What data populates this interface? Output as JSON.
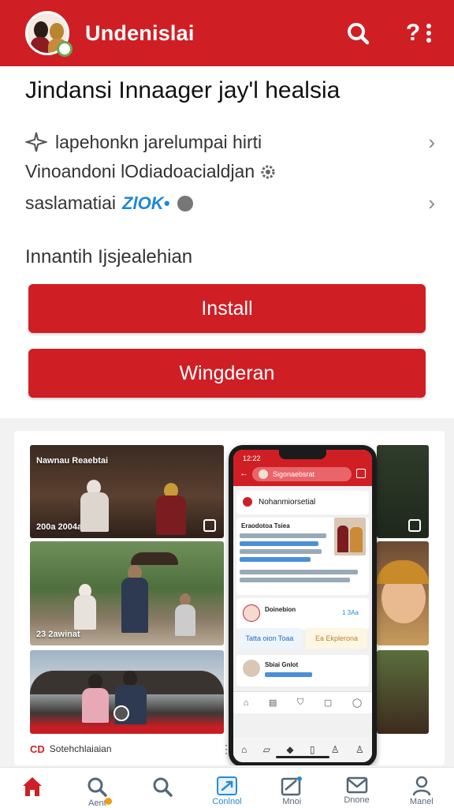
{
  "header": {
    "title": "Undenislai",
    "search_icon": "search-icon",
    "help_label": "?",
    "more_icon": "more-vertical-icon",
    "accent": "#cf1f24"
  },
  "info": {
    "title": "Jindansi Innaager jay'l healsia",
    "rows": [
      {
        "icon": "sparkle-icon",
        "text": "lapehonkn jarelumpai hirti",
        "chevron": "›"
      },
      {
        "text": "Vinoandoni lOdiadoacialdjan",
        "tail_icon": "settings-icon"
      },
      {
        "text": "saslamatiai",
        "tag": "ZlOK•",
        "tail_icon": "globe-icon",
        "chevron": "›"
      }
    ],
    "section_label": "Innantih Ijsjealehian",
    "install_label": "Install",
    "secondary_label": "Wingderan"
  },
  "gallery": {
    "photo1_label": "Nawnau Reaebtai",
    "photo1_sub": "200a 2004aan",
    "photo2_label": "23 2awinat",
    "footer_logo": "CD",
    "footer_text": "Sotehchlaiaian",
    "footer_dots": "⋮"
  },
  "phone": {
    "time": "12:22",
    "search_text": "Sigonaebsrat",
    "card_title": "Nohanmiorsetial",
    "card_sub": "Eraodotoa Tsiea",
    "list_name": "Doinebion",
    "list_value": "1 3Aa",
    "chip1": "Tatta oion Toaa",
    "chip2": "Ea Ekplerona",
    "list2_name": "Sbiai Gnlot"
  },
  "bottom_nav": [
    {
      "icon": "home-icon",
      "label": "",
      "active": true
    },
    {
      "icon": "search-icon",
      "label": "Aent",
      "badge": true
    },
    {
      "icon": "search-icon",
      "label": ""
    },
    {
      "icon": "send-icon",
      "label": "Conlnol",
      "active_label": true
    },
    {
      "icon": "edit-mail-icon",
      "label": "Mnoi"
    },
    {
      "icon": "mail-icon",
      "label": "Dnone"
    },
    {
      "icon": "person-icon",
      "label": "Manel"
    }
  ]
}
